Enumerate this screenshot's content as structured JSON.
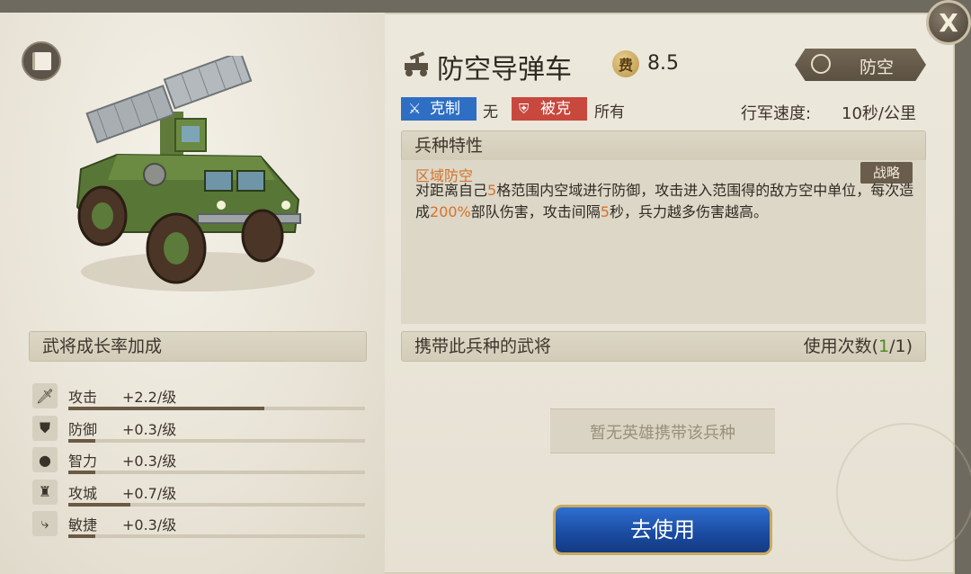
{
  "unit": {
    "name": "防空导弹车",
    "cost_icon_label": "费",
    "cost": "8.5",
    "type": "防空",
    "counters_label": "克制",
    "counters_value": "无",
    "countered_by_label": "被克",
    "countered_by_value": "所有",
    "march_speed_label": "行军速度:",
    "march_speed_value": "10秒/公里"
  },
  "traits": {
    "header": "兵种特性",
    "trait_name": "区域防空",
    "trait_tag": "战略",
    "desc_1": "对距离自己",
    "desc_hl_1": "5",
    "desc_2": "格范围内空域进行防御，攻击进入范围得的敌方空中单位，每次造成",
    "desc_hl_2": "200%",
    "desc_3": "部队伤害，攻击间隔",
    "desc_hl_3": "5",
    "desc_4": "秒，兵力越多伤害越高。"
  },
  "generals": {
    "header": "携带此兵种的武将",
    "uses_label": "使用次数(",
    "uses_current": "1",
    "uses_total": "/1)",
    "empty_text": "暂无英雄携带该兵种",
    "use_button": "去使用"
  },
  "growth": {
    "header": "武将成长率加成",
    "stats": [
      {
        "name": "攻击",
        "value": "+2.2/级",
        "fill": 0.66,
        "icon": "sword-icon"
      },
      {
        "name": "防御",
        "value": "+0.3/级",
        "fill": 0.09,
        "icon": "shield-icon"
      },
      {
        "name": "智力",
        "value": "+0.3/级",
        "fill": 0.09,
        "icon": "head-icon"
      },
      {
        "name": "攻城",
        "value": "+0.7/级",
        "fill": 0.21,
        "icon": "tower-icon"
      },
      {
        "name": "敏捷",
        "value": "+0.3/级",
        "fill": 0.09,
        "icon": "boot-icon"
      }
    ]
  },
  "close_label": "X",
  "colors": {
    "accent_orange": "#d4732a",
    "counter_blue": "#2e6fc4",
    "counter_red": "#c8483e",
    "button_blue": "#1a4aa0"
  }
}
